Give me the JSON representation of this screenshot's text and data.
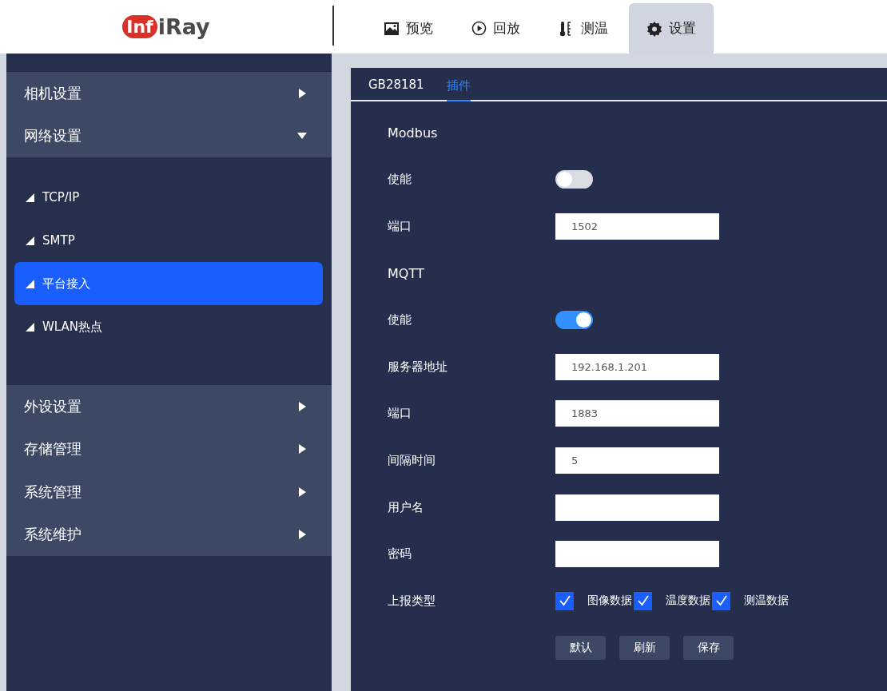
{
  "logo": {
    "mark": "Inf",
    "rest": "iRay"
  },
  "nav_tabs": [
    {
      "label": "预览",
      "kind": "image",
      "selected": false
    },
    {
      "label": "回放",
      "kind": "play",
      "selected": false
    },
    {
      "label": "测温",
      "kind": "thermo",
      "selected": false
    },
    {
      "label": "设置",
      "kind": "gear",
      "selected": true
    }
  ],
  "sidebar": {
    "groups": [
      {
        "label": "相机设置",
        "expanded": false
      },
      {
        "label": "网络设置",
        "expanded": true,
        "children": [
          {
            "label": "TCP/IP",
            "selected": false
          },
          {
            "label": "SMTP",
            "selected": false
          },
          {
            "label": "平台接入",
            "selected": true
          },
          {
            "label": "WLAN热点",
            "selected": false
          }
        ]
      },
      {
        "label": "外设设置",
        "expanded": false
      },
      {
        "label": "存储管理",
        "expanded": false
      },
      {
        "label": "系统管理",
        "expanded": false
      },
      {
        "label": "系统维护",
        "expanded": false
      }
    ]
  },
  "sub_tabs": [
    {
      "label": "GB28181",
      "selected": false
    },
    {
      "label": "插件",
      "selected": true
    }
  ],
  "form": [
    {
      "kind": "heading",
      "label": "Modbus"
    },
    {
      "kind": "toggle",
      "label": "使能",
      "on": false
    },
    {
      "kind": "field",
      "label": "端口",
      "value": "1502"
    },
    {
      "kind": "heading",
      "label": "MQTT"
    },
    {
      "kind": "toggle",
      "label": "使能",
      "on": true
    },
    {
      "kind": "field",
      "label": "服务器地址",
      "value": "192.168.1.201"
    },
    {
      "kind": "field",
      "label": "端口",
      "value": "1883"
    },
    {
      "kind": "field",
      "label": "间隔时间",
      "value": "5"
    },
    {
      "kind": "field",
      "label": "用户名"
    },
    {
      "kind": "field",
      "label": "密码"
    },
    {
      "kind": "checks",
      "label": "上报类型",
      "options": [
        {
          "label": "图像数据",
          "checked": true
        },
        {
          "label": "温度数据",
          "checked": true
        },
        {
          "label": "测温数据",
          "checked": true
        }
      ]
    }
  ],
  "buttons": [
    "默认",
    "刷新",
    "保存"
  ]
}
